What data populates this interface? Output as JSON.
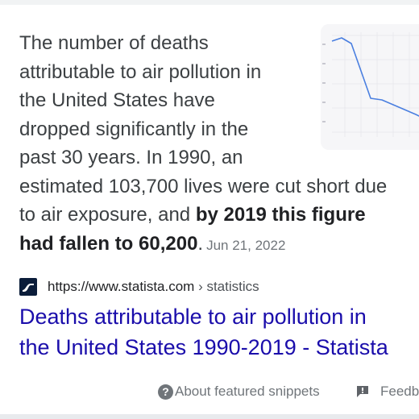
{
  "snippet": {
    "line1": "The number of deaths",
    "line2": "attributable to air pollution in",
    "line3": "the United States have",
    "line4": "dropped significantly in the",
    "line5": "past 30 years. In 1990, an",
    "line6": "estimated 103,700 lives were cut short due",
    "line7_plain": "to air exposure, and ",
    "line7_bold": "by 2019 this figure",
    "line8_bold": "had fallen to 60,200",
    "line8_plain": ".",
    "date": "Jun 21, 2022"
  },
  "source": {
    "url": "https://www.statista.com",
    "path": " › statistics"
  },
  "result_title": {
    "line1": "Deaths attributable to air pollution in",
    "line2": "the United States 1990-2019 - Statista"
  },
  "footer": {
    "about_label": "About featured snippets",
    "feedback_label": "Feedback"
  },
  "colors": {
    "link": "#1a0dab",
    "text": "#3c4043",
    "muted": "#70757a",
    "chart_line": "#4a7fe0"
  },
  "icons": {
    "help": "help-circle-icon",
    "feedback": "feedback-flag-icon",
    "favicon": "statista-favicon"
  }
}
